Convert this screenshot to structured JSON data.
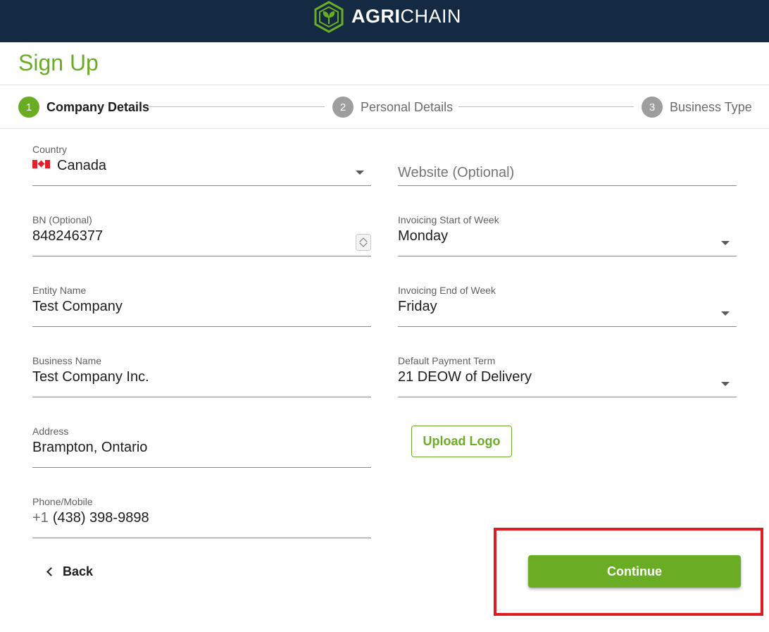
{
  "brand": {
    "name_bold": "AGRI",
    "name_light": "CHAIN",
    "logo_icon": "hexagon-leaf-icon",
    "header_color": "#132a42",
    "accent_color": "#6aad25"
  },
  "page": {
    "title": "Sign Up"
  },
  "stepper": {
    "steps": [
      {
        "number": "1",
        "label": "Company Details",
        "state": "active"
      },
      {
        "number": "2",
        "label": "Personal Details",
        "state": "inactive"
      },
      {
        "number": "3",
        "label": "Business Type",
        "state": "inactive"
      }
    ]
  },
  "form": {
    "country": {
      "label": "Country",
      "value": "Canada",
      "flag_icon": "canada-flag-icon"
    },
    "website": {
      "placeholder": "Website (Optional)"
    },
    "bn": {
      "label": "BN (Optional)",
      "value": "848246377"
    },
    "invoicing_start": {
      "label": "Invoicing Start of Week",
      "value": "Monday"
    },
    "entity_name": {
      "label": "Entity Name",
      "value": "Test Company"
    },
    "invoicing_end": {
      "label": "Invoicing End of Week",
      "value": "Friday"
    },
    "business_name": {
      "label": "Business Name",
      "value": "Test Company Inc."
    },
    "payment_term": {
      "label": "Default Payment Term",
      "value": "21 DEOW of Delivery"
    },
    "address": {
      "label": "Address",
      "value": "Brampton, Ontario"
    },
    "phone": {
      "label": "Phone/Mobile",
      "prefix": "+1",
      "value": "(438) 398-9898"
    }
  },
  "actions": {
    "upload_logo": "Upload Logo",
    "back": "Back",
    "continue": "Continue",
    "highlight_color": "#e01b22"
  }
}
